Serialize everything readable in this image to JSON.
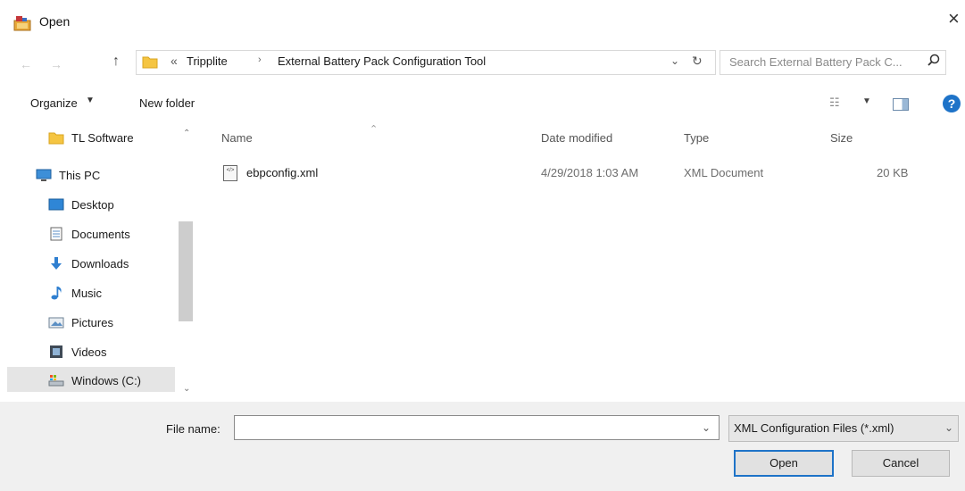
{
  "window": {
    "title": "Open",
    "close_glyph": "×"
  },
  "address": {
    "overflow_glyph": "«",
    "crumbs": [
      "Tripplite",
      "External Battery Pack Configuration Tool"
    ],
    "separator": "›"
  },
  "search": {
    "placeholder": "Search External Battery Pack C..."
  },
  "toolbar": {
    "organize_label": "Organize",
    "new_folder_label": "New folder",
    "help_glyph": "?"
  },
  "nav": {
    "items": [
      {
        "label": "TL Software",
        "icon": "folder-icon"
      },
      {
        "label": "This PC",
        "icon": "computer-icon"
      },
      {
        "label": "Desktop",
        "icon": "desktop-icon"
      },
      {
        "label": "Documents",
        "icon": "documents-icon"
      },
      {
        "label": "Downloads",
        "icon": "downloads-icon"
      },
      {
        "label": "Music",
        "icon": "music-icon"
      },
      {
        "label": "Pictures",
        "icon": "pictures-icon"
      },
      {
        "label": "Videos",
        "icon": "videos-icon"
      },
      {
        "label": "Windows (C:)",
        "icon": "drive-icon"
      }
    ]
  },
  "columns": {
    "name": "Name",
    "date": "Date modified",
    "type": "Type",
    "size": "Size"
  },
  "files": [
    {
      "name": "ebpconfig.xml",
      "date": "4/29/2018 1:03 AM",
      "type": "XML Document",
      "size": "20 KB"
    }
  ],
  "bottom": {
    "file_name_label": "File name:",
    "file_name_value": "",
    "file_type": "XML Configuration Files (*.xml)",
    "open_label": "Open",
    "cancel_label": "Cancel"
  },
  "colors": {
    "accent": "#1e73c8",
    "folder": "#f5c542",
    "bottom_bg": "#f0f0f0",
    "selected_bg": "#e5e5e5"
  }
}
